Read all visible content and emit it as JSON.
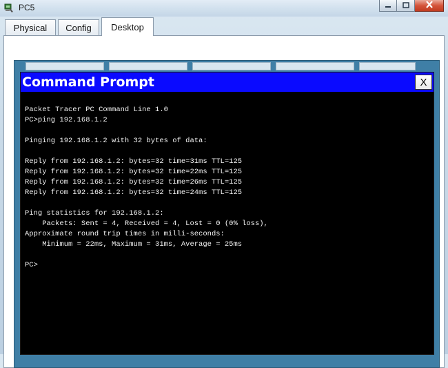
{
  "window": {
    "title": "PC5",
    "icons": {
      "app": "pc-icon",
      "minimize": "minimize-icon",
      "maximize": "maximize-icon",
      "close": "close-icon"
    }
  },
  "tabs": [
    {
      "label": "Physical",
      "active": false
    },
    {
      "label": "Config",
      "active": false
    },
    {
      "label": "Desktop",
      "active": true
    }
  ],
  "command_prompt": {
    "title": "Command Prompt",
    "close_label": "X",
    "lines": [
      "Packet Tracer PC Command Line 1.0",
      "PC>ping 192.168.1.2",
      "",
      "Pinging 192.168.1.2 with 32 bytes of data:",
      "",
      "Reply from 192.168.1.2: bytes=32 time=31ms TTL=125",
      "Reply from 192.168.1.2: bytes=32 time=22ms TTL=125",
      "Reply from 192.168.1.2: bytes=32 time=26ms TTL=125",
      "Reply from 192.168.1.2: bytes=32 time=24ms TTL=125",
      "",
      "Ping statistics for 192.168.1.2:",
      "    Packets: Sent = 4, Received = 4, Lost = 0 (0% loss),",
      "Approximate round trip times in milli-seconds:",
      "    Minimum = 22ms, Maximum = 31ms, Average = 25ms",
      "",
      "PC>"
    ]
  },
  "colors": {
    "prompt_title_bar": "#0a0aff",
    "terminal_bg": "#000000",
    "terminal_text": "#f2f2f2"
  }
}
